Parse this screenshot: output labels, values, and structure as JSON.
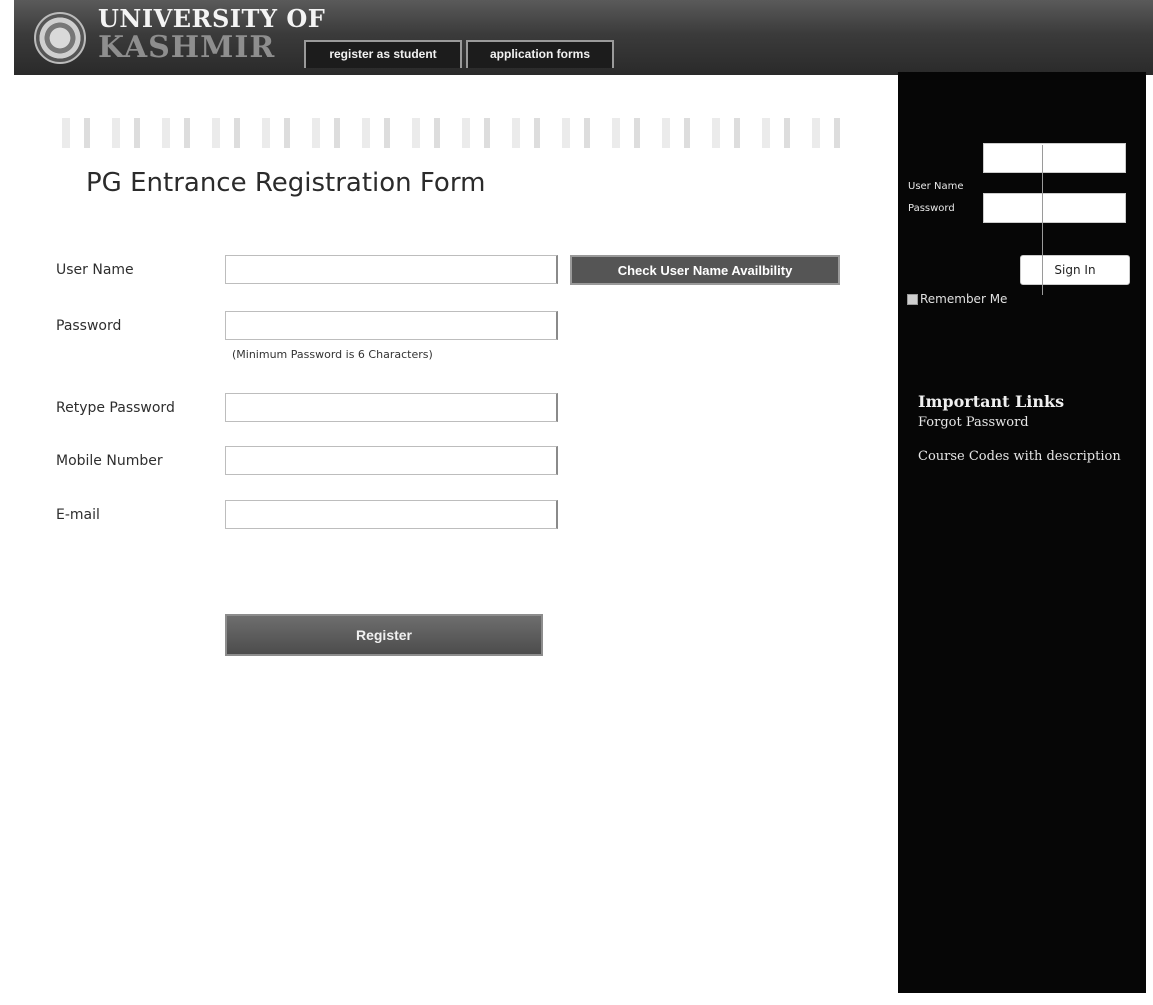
{
  "header": {
    "brand_line1": "UNIVERSITY OF",
    "brand_line2": "KASHMIR",
    "tabs": [
      {
        "label": "register as student"
      },
      {
        "label": "application forms"
      }
    ]
  },
  "form": {
    "title": "PG Entrance Registration Form",
    "fields": [
      {
        "label": "User Name",
        "value": ""
      },
      {
        "label": "Password",
        "value": ""
      },
      {
        "label": "Retype Password",
        "value": ""
      },
      {
        "label": "Mobile Number",
        "value": ""
      },
      {
        "label": "E-mail",
        "value": ""
      }
    ],
    "password_hint": "(Minimum Password is 6 Characters)",
    "check_button": "Check User Name Availbility",
    "register_button": "Register"
  },
  "sidebar": {
    "username_label": "User Name",
    "password_label": "Password",
    "signin_button": "Sign In",
    "remember_label": "Remember Me",
    "links_title": "Important Links",
    "links": [
      {
        "label": "Forgot Password"
      },
      {
        "label": "Course Codes with description"
      }
    ]
  }
}
